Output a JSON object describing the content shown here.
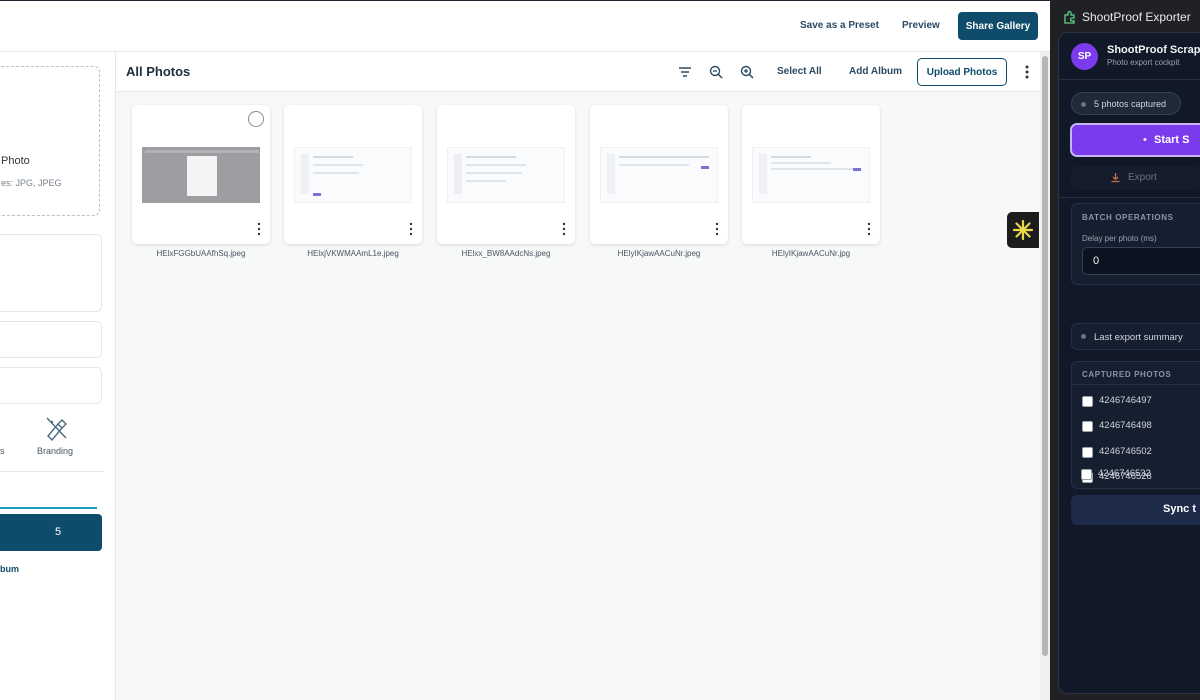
{
  "topbar": {
    "save_preset": "Save as a Preset",
    "preview": "Preview",
    "share_gallery": "Share Gallery"
  },
  "left": {
    "dropzone_title": "Photo",
    "dropzone_sub": "es: JPG, JPEG",
    "tab_left_partial": "s",
    "branding": "Branding",
    "album_count": "5",
    "add_album_partial": "bum"
  },
  "content": {
    "title": "All Photos",
    "select_all": "Select All",
    "add_album": "Add Album",
    "upload_photos": "Upload Photos",
    "photos": [
      {
        "name": "HElxFGGbUAAfhSq.jpeg"
      },
      {
        "name": "HElxjVKWMAAmL1e.jpeg"
      },
      {
        "name": "HElxx_BW8AAdcNs.jpeg"
      },
      {
        "name": "HElyIKjawAACuNr.jpeg"
      },
      {
        "name": "HElyIKjawAACuNr.jpg"
      }
    ]
  },
  "extension": {
    "window_title": "ShootProof Exporter",
    "avatar": "SP",
    "title": "ShootProof Scrap",
    "subtitle": "Photo export cockpit",
    "status_pill": "5 photos captured",
    "start_button": "Start S",
    "export_button": "Export",
    "batch_heading": "BATCH OPERATIONS",
    "delay_label": "Delay per photo (ms)",
    "delay_value": "0",
    "summary": "Last export summary",
    "captured_heading": "CAPTURED PHOTOS",
    "captured_ids": [
      "4246746497",
      "4246746498",
      "4246746502",
      "4246746528",
      "4246746532"
    ],
    "sync_button": "Sync t"
  },
  "colors": {
    "brand_navy": "#0f4c6b",
    "accent_teal": "#1a9fc0",
    "ext_purple": "#7c3aed",
    "ext_bg": "#111827"
  }
}
